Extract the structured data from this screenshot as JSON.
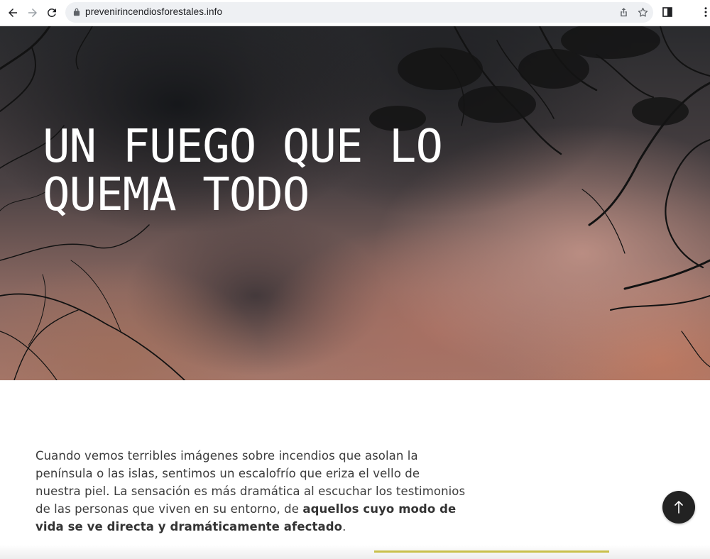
{
  "browser": {
    "url": "prevenirincendiosforestales.info",
    "icons": [
      "back-arrow-icon",
      "forward-arrow-icon",
      "reload-icon",
      "lock-icon",
      "share-icon",
      "star-icon",
      "side-panel-icon",
      "more-vert-icon"
    ]
  },
  "hero": {
    "title": "UN FUEGO QUE LO QUEMA TODO"
  },
  "intro": {
    "text_start": "Cuando vemos terribles imágenes sobre incendios que asolan la península o las islas, sentimos un escalofrío que eriza el vello de nuestra piel. La sensación es más dramática al escuchar los testimonios de las personas que viven en su entorno, de ",
    "text_bold": "aquellos cuyo modo de vida se ve directa y dramáticamente afectado",
    "text_end": "."
  },
  "colors": {
    "accent_line": "#c9c04a",
    "scroll_button": "#222222"
  }
}
